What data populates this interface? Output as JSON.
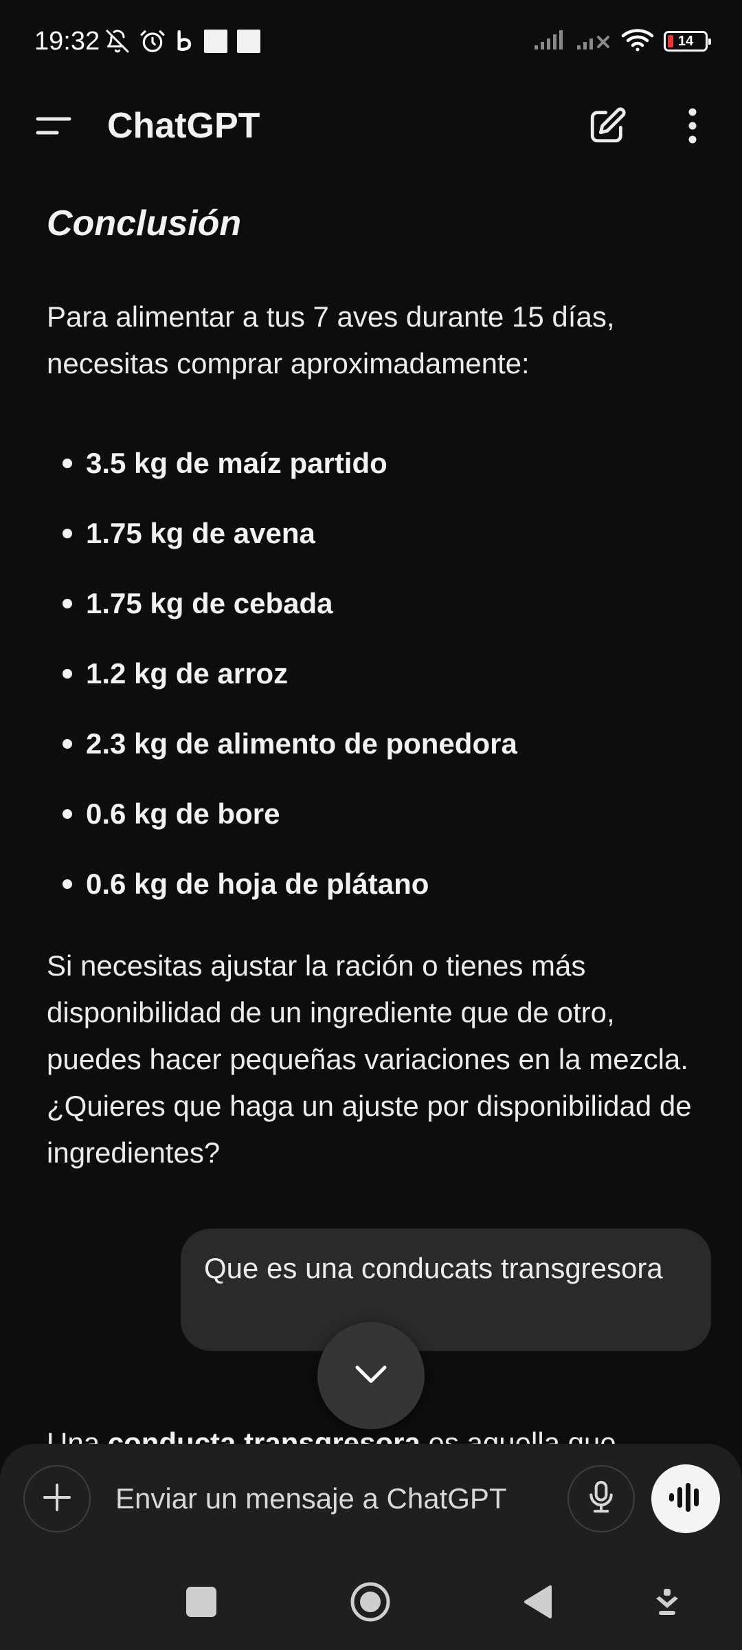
{
  "status_bar": {
    "time": "19:32",
    "battery_level": "14",
    "icons": [
      "bell-off-icon",
      "alarm-icon",
      "b-app-icon",
      "square-notif-icon",
      "square-notif-icon",
      "signal-icon",
      "signal-no-service-icon",
      "wifi-icon",
      "battery-icon"
    ]
  },
  "header": {
    "title": "ChatGPT",
    "icons": [
      "menu-icon",
      "new-chat-icon",
      "more-vert-icon"
    ]
  },
  "message": {
    "heading": "Conclusión",
    "intro": "Para alimentar a tus 7 aves durante 15 días, necesitas comprar aproximadamente:",
    "items": [
      "3.5 kg de maíz partido",
      "1.75 kg de avena",
      "1.75 kg de cebada",
      "1.2 kg de arroz",
      "2.3 kg de alimento de ponedora",
      "0.6 kg de bore",
      "0.6 kg de hoja de plátano"
    ],
    "outro": "Si necesitas ajustar la ración o tienes más disponibilidad de un ingrediente que de otro, puedes hacer pequeñas variaciones en la mezcla. ¿Quieres que haga un ajuste por disponibilidad de ingredientes?"
  },
  "user_message": "Que es una conducats transgresora",
  "reply": {
    "prefix": "Una ",
    "bold": "conducta transgresora",
    "suffix": " es aquella que"
  },
  "composer": {
    "placeholder": "Enviar un mensaje a ChatGPT",
    "icons": [
      "plus-icon",
      "microphone-icon",
      "voice-mode-icon"
    ]
  },
  "nav_bar": {
    "icons": [
      "recents-square-icon",
      "home-circle-icon",
      "back-triangle-icon",
      "hide-keyboard-icon"
    ]
  },
  "colors": {
    "background": "#0d0d0d",
    "text": "#ececec",
    "bubble": "#2a2a2a",
    "composer": "#1f1f1f",
    "battery_low": "#e53935"
  }
}
